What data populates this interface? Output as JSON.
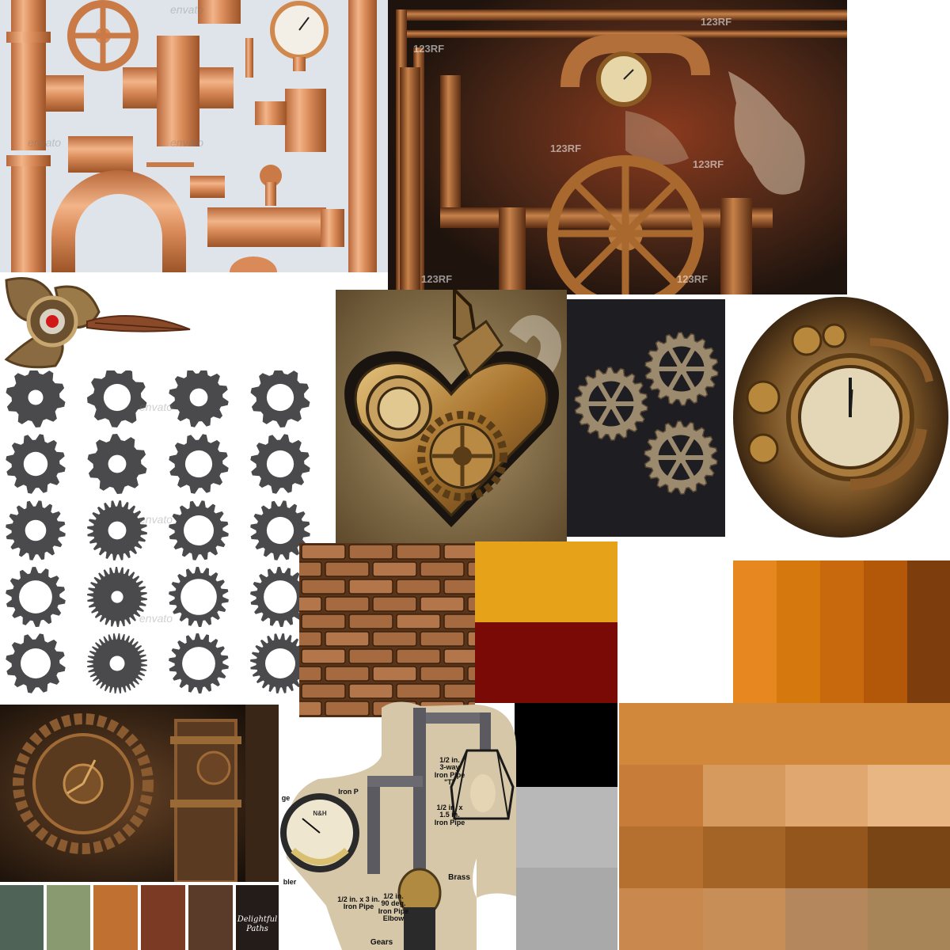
{
  "collage": {
    "watermarks": {
      "envato": "envato",
      "rf": "123RF"
    },
    "logo": {
      "line1": "Delightful",
      "line2": "Paths"
    },
    "lamp_labels": {
      "three_way": "1/2 in.\n3-way\nIron Pipe\n\"T\"",
      "half_x_one_half": "1/2 in. x\n1.5 in.\nIron Pipe",
      "half_x_three": "1/2 in. x 3 in.\nIron Pipe",
      "elbow": "1/2 in.\n90 deg.\nIron Pipe\nElbow",
      "gears": "Gears",
      "brass": "Brass",
      "iron_p": "Iron P",
      "gauge": "ge",
      "bler": "bler"
    },
    "gauge_text": "N&H"
  },
  "palettes": {
    "mid_column": [
      "#E6A219",
      "#7A0A06",
      "#000000",
      "#B8B8B8",
      "#A9A9A9"
    ],
    "orange_strip": [
      "#E6871F",
      "#D5780E",
      "#C7690C",
      "#B25808",
      "#7E3D0D"
    ],
    "big_grid_top": "#D1883A",
    "big_grid": [
      [
        "#C77C3A",
        "#D69A5E",
        "#E0A870",
        "#E8B683"
      ],
      [
        "#B5702F",
        "#A46426",
        "#94561D",
        "#7A4515"
      ],
      [
        "#C8884E",
        "#C88E58",
        "#B4885C",
        "#A88459"
      ]
    ],
    "bottom_left": [
      "#4F6357",
      "#8A9A70",
      "#C07030",
      "#7A3A24",
      "#5A3A28",
      "#241C18"
    ]
  }
}
